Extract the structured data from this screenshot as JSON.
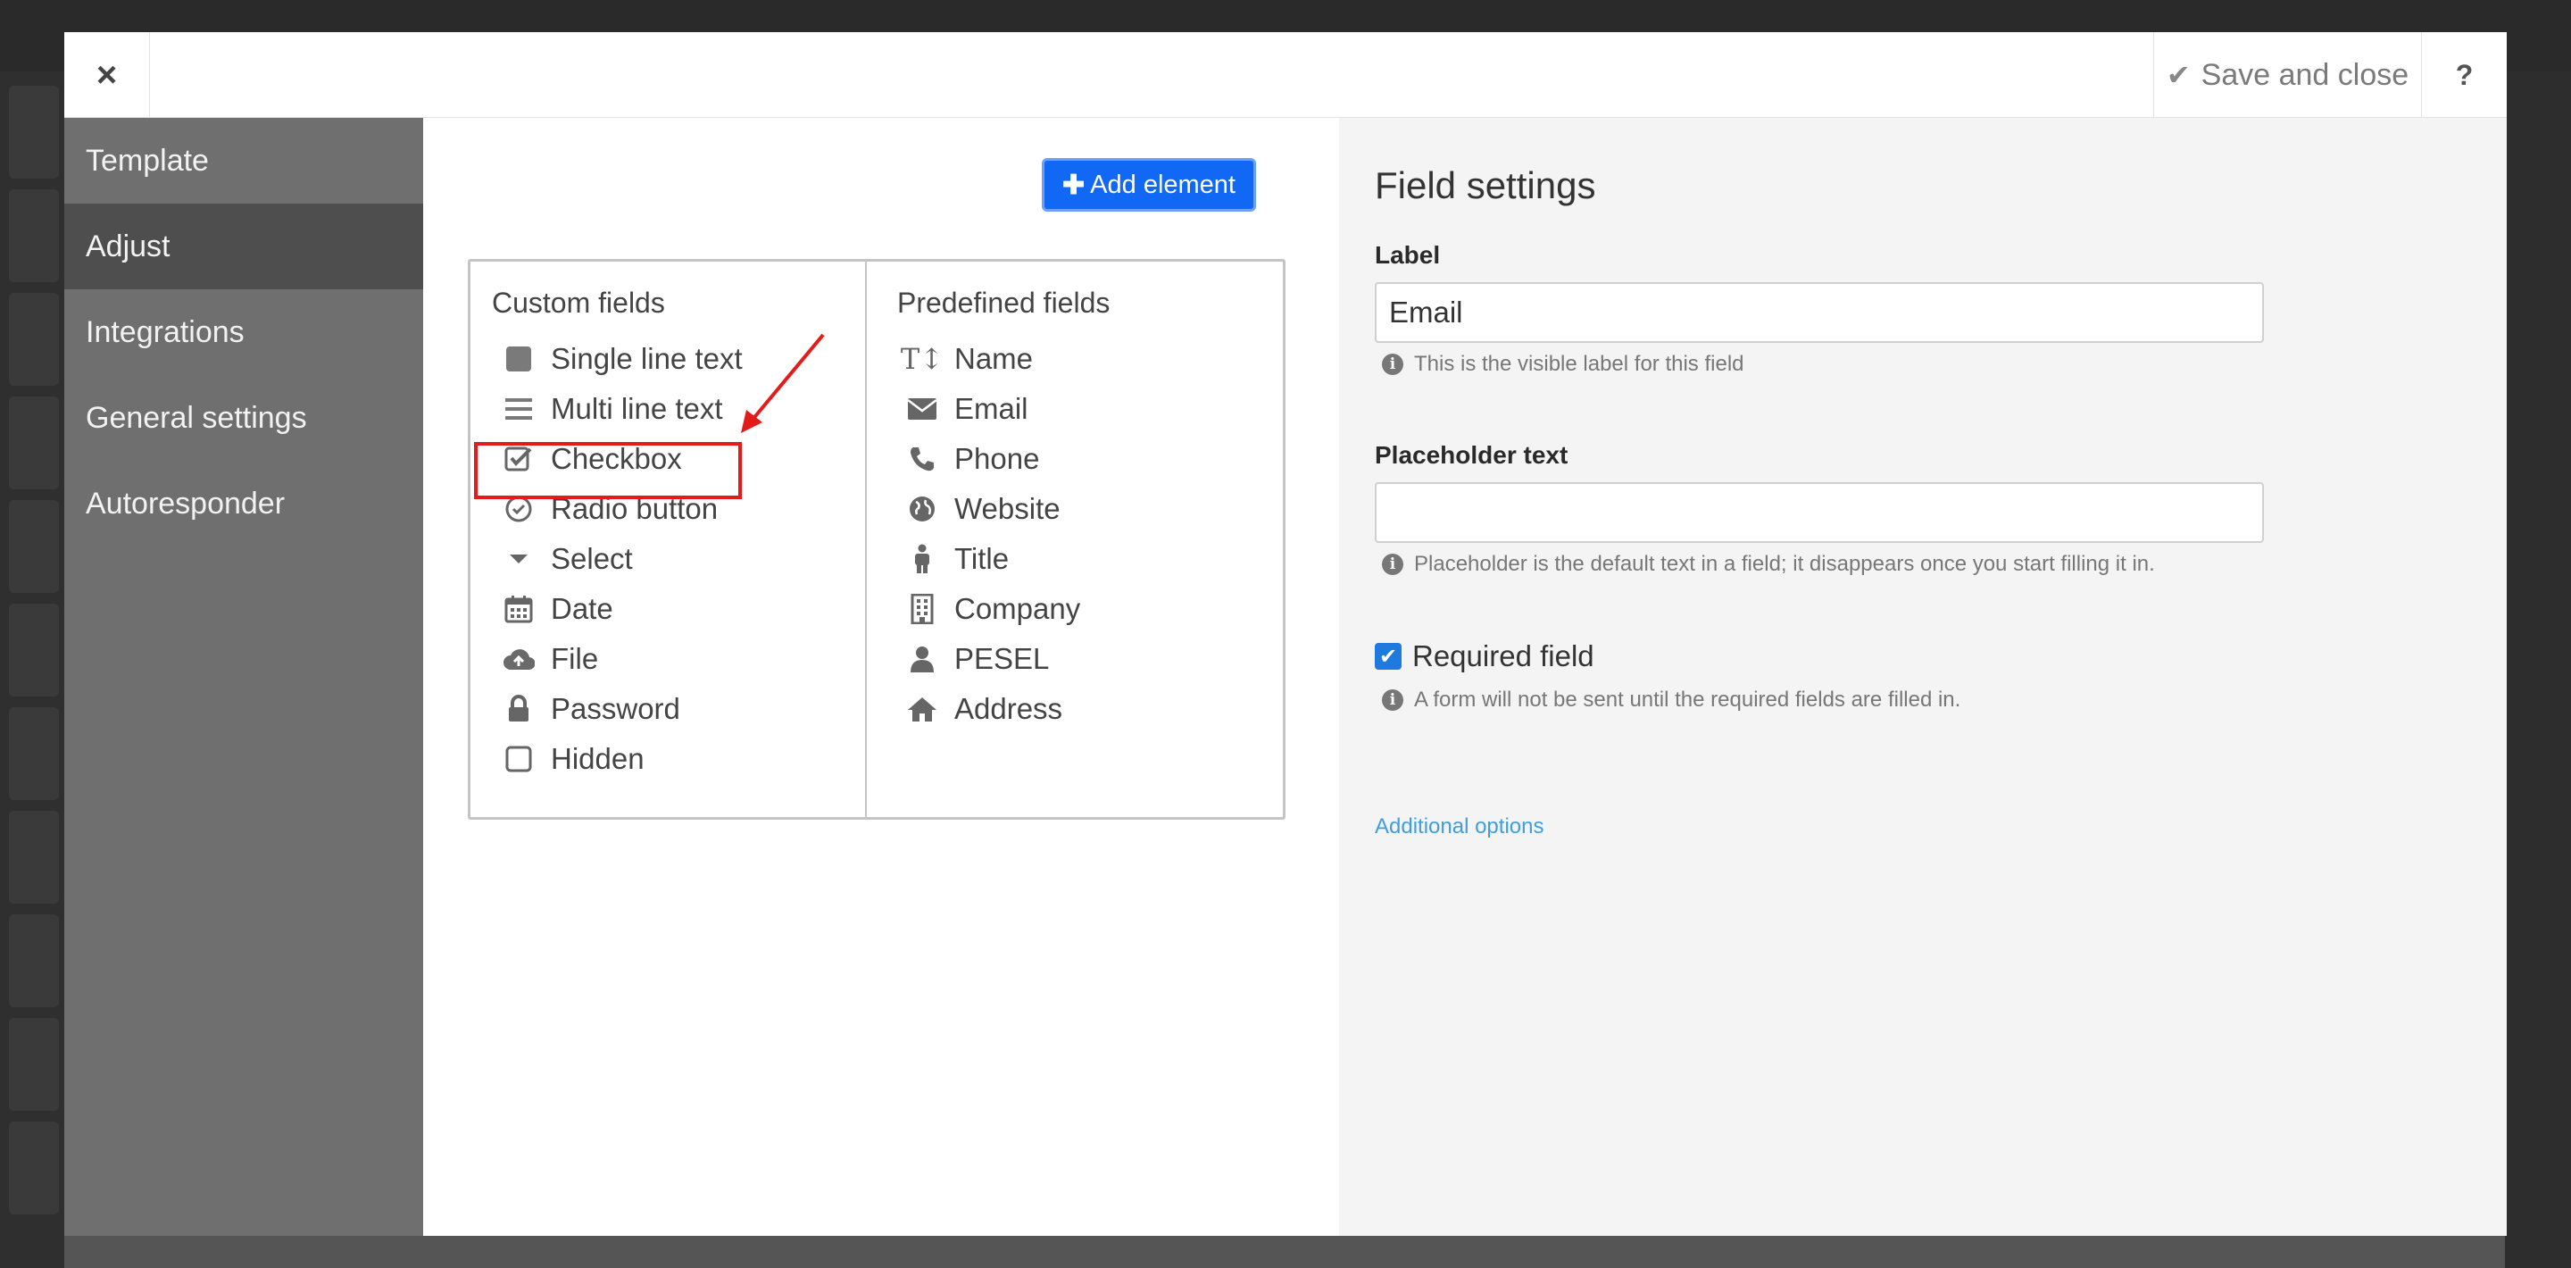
{
  "header": {
    "close_glyph": "×",
    "save_label": "Save and close",
    "help_label": "?"
  },
  "sidebar": {
    "items": [
      {
        "label": "Template",
        "active": false
      },
      {
        "label": "Adjust",
        "active": true
      },
      {
        "label": "Integrations",
        "active": false
      },
      {
        "label": "General settings",
        "active": false
      },
      {
        "label": "Autoresponder",
        "active": false
      }
    ]
  },
  "center": {
    "add_element_label": "Add element",
    "custom_fields": {
      "title": "Custom fields",
      "items": [
        {
          "label": "Single line text",
          "icon": "square-icon"
        },
        {
          "label": "Multi line text",
          "icon": "lines-icon"
        },
        {
          "label": "Checkbox",
          "icon": "checkbox-icon"
        },
        {
          "label": "Radio button",
          "icon": "radio-icon"
        },
        {
          "label": "Select",
          "icon": "caret-down-icon"
        },
        {
          "label": "Date",
          "icon": "calendar-icon"
        },
        {
          "label": "File",
          "icon": "cloud-upload-icon"
        },
        {
          "label": "Password",
          "icon": "lock-icon"
        },
        {
          "label": "Hidden",
          "icon": "empty-square-icon"
        }
      ]
    },
    "predefined_fields": {
      "title": "Predefined fields",
      "items": [
        {
          "label": "Name",
          "icon": "text-height-icon"
        },
        {
          "label": "Email",
          "icon": "envelope-icon"
        },
        {
          "label": "Phone",
          "icon": "phone-icon"
        },
        {
          "label": "Website",
          "icon": "globe-icon"
        },
        {
          "label": "Title",
          "icon": "person-icon"
        },
        {
          "label": "Company",
          "icon": "building-icon"
        },
        {
          "label": "PESEL",
          "icon": "user-icon"
        },
        {
          "label": "Address",
          "icon": "home-icon"
        }
      ]
    }
  },
  "field_settings": {
    "title": "Field settings",
    "label_title": "Label",
    "label_value": "Email",
    "label_hint": "This is the visible label for this field",
    "placeholder_title": "Placeholder text",
    "placeholder_value": "",
    "placeholder_hint": "Placeholder is the default text in a field; it disappears once you start filling it in.",
    "required_label": "Required field",
    "required_checked": true,
    "required_hint": "A form will not be sent until the required fields are filled in.",
    "additional_options": "Additional options"
  },
  "colors": {
    "accent": "#1168f5",
    "annotation": "#e31b1b",
    "link": "#3d9fe0",
    "sidebar": "#6f6f6f",
    "sidebar_active": "#4e4e4e"
  }
}
